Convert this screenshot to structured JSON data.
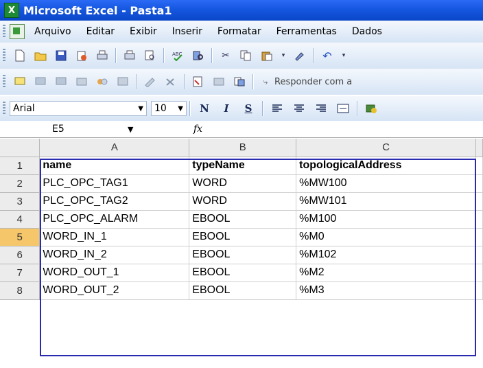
{
  "window": {
    "title": "Microsoft Excel - Pasta1",
    "app_icon": "excel-icon"
  },
  "menu": {
    "items": [
      "Arquivo",
      "Editar",
      "Exibir",
      "Inserir",
      "Formatar",
      "Ferramentas",
      "Dados"
    ]
  },
  "toolbar2": {
    "reply_label": "Responder com a"
  },
  "format": {
    "font": "Arial",
    "size": "10",
    "bold": "N",
    "italic": "I",
    "underline": "S"
  },
  "formula_bar": {
    "name_box": "E5",
    "fx": "fx",
    "value": ""
  },
  "sheet": {
    "columns": [
      "A",
      "B",
      "C"
    ],
    "rows": [
      {
        "num": "1",
        "a": "name",
        "b": "typeName",
        "c": "topologicalAddress"
      },
      {
        "num": "2",
        "a": "PLC_OPC_TAG1",
        "b": "WORD",
        "c": "%MW100"
      },
      {
        "num": "3",
        "a": "PLC_OPC_TAG2",
        "b": "WORD",
        "c": "%MW101"
      },
      {
        "num": "4",
        "a": "PLC_OPC_ALARM",
        "b": "EBOOL",
        "c": "%M100"
      },
      {
        "num": "5",
        "a": "WORD_IN_1",
        "b": "EBOOL",
        "c": "%M0"
      },
      {
        "num": "6",
        "a": "WORD_IN_2",
        "b": "EBOOL",
        "c": "%M102"
      },
      {
        "num": "7",
        "a": "WORD_OUT_1",
        "b": "EBOOL",
        "c": "%M2"
      },
      {
        "num": "8",
        "a": "WORD_OUT_2",
        "b": "EBOOL",
        "c": "%M3"
      }
    ],
    "active_row": "5"
  },
  "colors": {
    "title_bar": "#0a46c8",
    "selection_border": "#2a2ab0",
    "active_row_header": "#f6c76a"
  }
}
